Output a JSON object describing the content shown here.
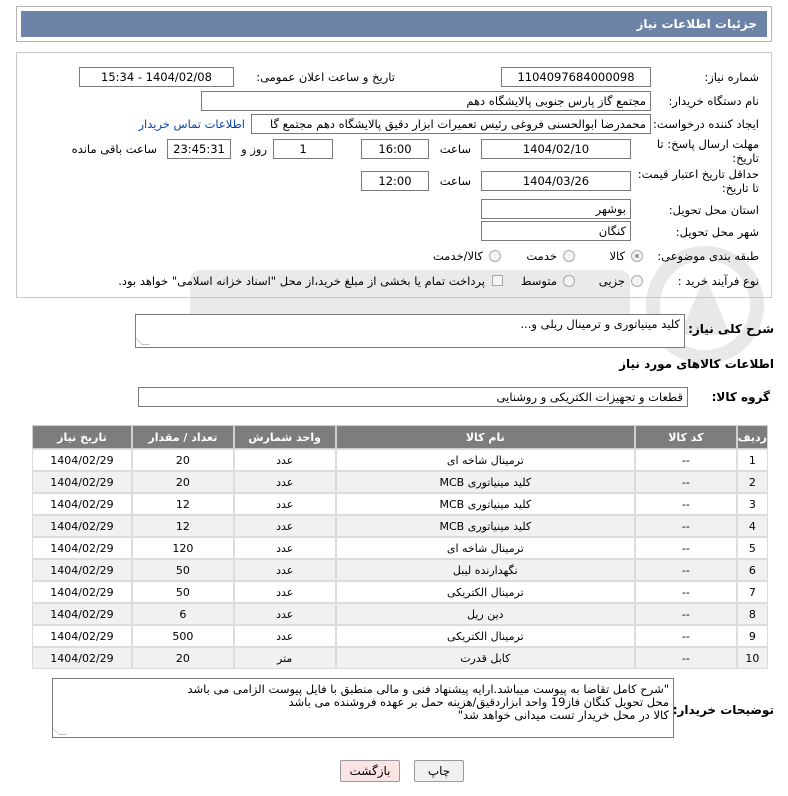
{
  "header": {
    "title": "جزئیات اطلاعات نیاز"
  },
  "form": {
    "need_number_label": "شماره نیاز:",
    "need_number": "1104097684000098",
    "announce_label": "تاریخ و ساعت اعلان عمومی:",
    "announce_value": "1404/02/08 - 15:34",
    "buyer_org_label": "نام دستگاه خریدار:",
    "buyer_org": "مجتمع گاز پارس جنوبی  پالایشگاه دهم",
    "requester_label": "ایجاد کننده درخواست:",
    "requester": "محمدرضا ابوالحسنی فروغی رئیس تعمیرات ابزار دقیق پالایشگاه دهم  مجتمع گا",
    "buyer_contact_link": "اطلاعات تماس خریدار",
    "deadline_label_1": "مهلت ارسال پاسخ: تا",
    "deadline_label_2": "تاریخ:",
    "deadline_date": "1404/02/10",
    "time_label": "ساعت",
    "deadline_time": "16:00",
    "days_value": "1",
    "days_label": "روز و",
    "remaining_time": "23:45:31",
    "remaining_label": "ساعت باقی مانده",
    "validity_label_1": "حداقل تاریخ اعتبار قیمت:",
    "validity_label_2": "تا تاریخ:",
    "validity_date": "1404/03/26",
    "validity_time": "12:00",
    "province_label": "استان محل تحویل:",
    "province": "بوشهر",
    "city_label": "شهر محل تحویل:",
    "city": "کنگان",
    "category_label": "طبقه بندی موضوعی:",
    "category_options": [
      "کالا",
      "خدمت",
      "کالا/خدمت"
    ],
    "process_label": "نوع فرآیند خرید :",
    "process_options": [
      "جزیی",
      "متوسط"
    ],
    "payment_note": "پرداخت تمام یا بخشی از مبلغ خرید،از محل \"اسناد خزانه اسلامی\" خواهد بود."
  },
  "summary": {
    "label": "شرح کلی نیاز:",
    "value": "کلید مینیاتوری و ترمینال ریلی و..."
  },
  "goods": {
    "section_title": "اطلاعات کالاهای مورد نیاز",
    "group_label": "گروه کالا:",
    "group_value": "قطعات و تجهیزات الکتریکی و روشنایی",
    "columns": [
      "ردیف",
      "کد کالا",
      "نام کالا",
      "واحد شمارش",
      "تعداد / مقدار",
      "تاریخ نیاز"
    ],
    "rows": [
      [
        "1",
        "--",
        "ترمینال شاخه ای",
        "عدد",
        "20",
        "1404/02/29"
      ],
      [
        "2",
        "--",
        "کلید مینیاتوری MCB",
        "عدد",
        "20",
        "1404/02/29"
      ],
      [
        "3",
        "--",
        "کلید مینیاتوری MCB",
        "عدد",
        "12",
        "1404/02/29"
      ],
      [
        "4",
        "--",
        "کلید مینیاتوری MCB",
        "عدد",
        "12",
        "1404/02/29"
      ],
      [
        "5",
        "--",
        "ترمینال شاخه ای",
        "عدد",
        "120",
        "1404/02/29"
      ],
      [
        "6",
        "--",
        "نگهدارنده لیبل",
        "عدد",
        "50",
        "1404/02/29"
      ],
      [
        "7",
        "--",
        "ترمینال الکتریکی",
        "عدد",
        "50",
        "1404/02/29"
      ],
      [
        "8",
        "--",
        "دین ریل",
        "عدد",
        "6",
        "1404/02/29"
      ],
      [
        "9",
        "--",
        "ترمینال الکتریکی",
        "عدد",
        "500",
        "1404/02/29"
      ],
      [
        "10",
        "--",
        "کابل قدرت",
        "متر",
        "20",
        "1404/02/29"
      ]
    ]
  },
  "notes": {
    "label": "توضیحات خریدار:",
    "lines": [
      "\"شرح کامل تقاضا به پیوست میباشد.ارایه پیشنهاد فنی و مالی منطبق با فایل پیوست الزامی می باشد",
      "محل تحویل کنگان فاز19 واحد ابزاردقیق/هزینه حمل بر عهده فروشنده می باشد",
      "کالا در محل خریدار تست میدانی خواهد شد\""
    ]
  },
  "buttons": {
    "print": "چاپ",
    "back": "بازگشت"
  }
}
